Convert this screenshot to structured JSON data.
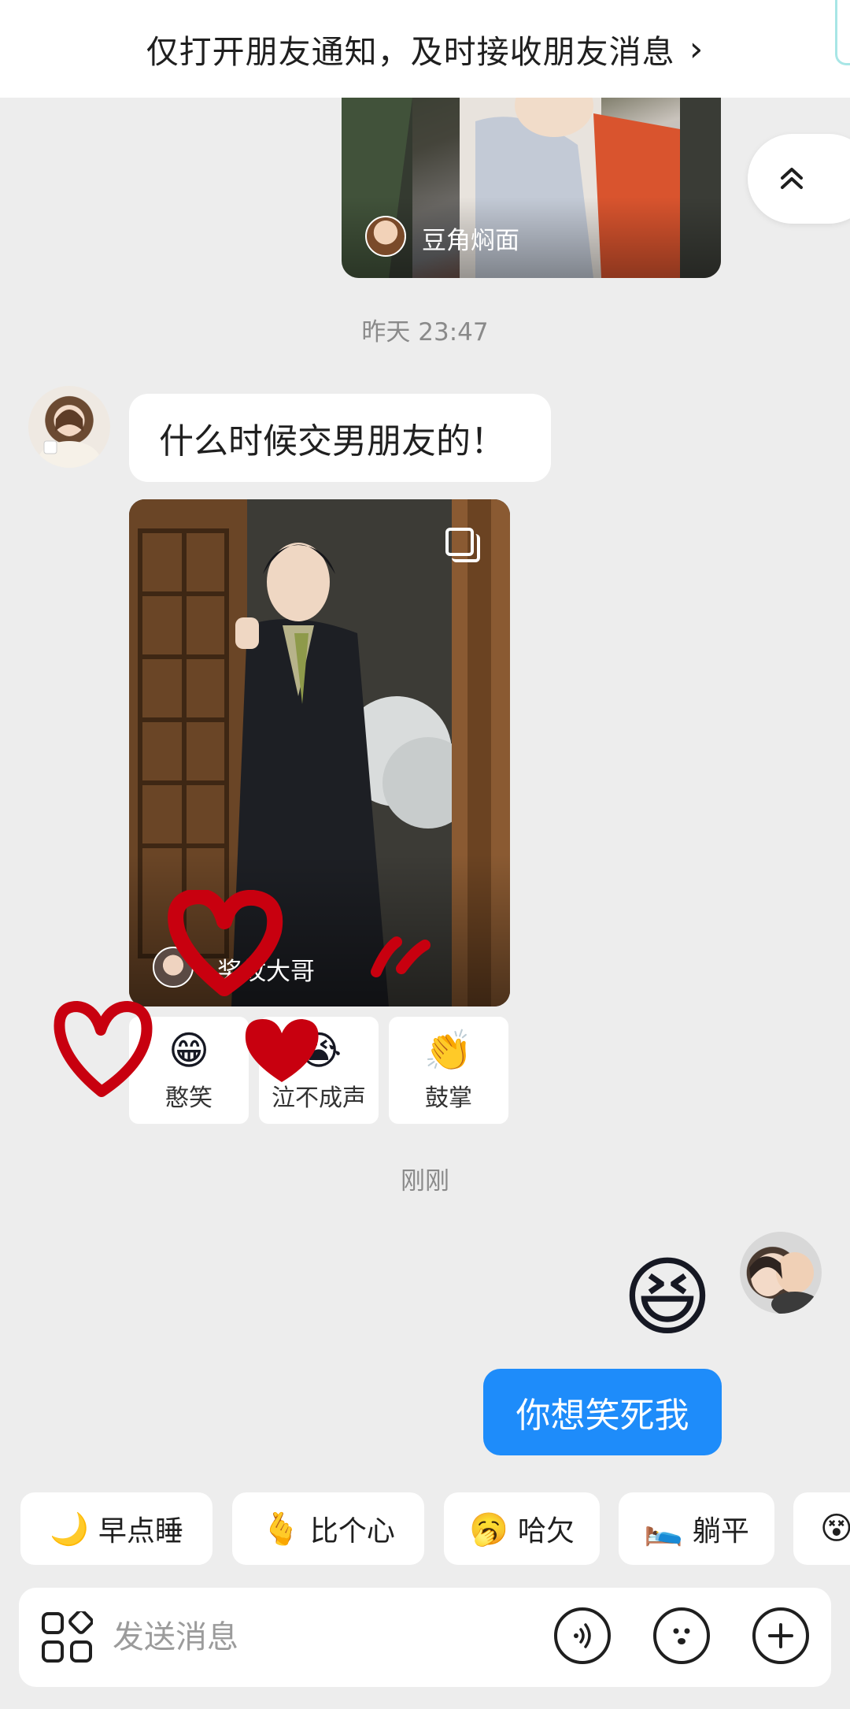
{
  "banner": {
    "text": "仅打开朋友通知，及时接收朋友消息",
    "chevron": "›"
  },
  "messages": {
    "card1": {
      "author": "豆角焖面"
    },
    "timestamp1": "昨天 23:47",
    "friend_text": "什么时候交男朋友的！",
    "card2": {
      "author": "奖纹大哥"
    },
    "reactions": [
      {
        "emoji": "😁",
        "label": "憨笑"
      },
      {
        "emoji": "😭",
        "label": "泣不成声"
      },
      {
        "emoji": "👏",
        "label": "鼓掌"
      }
    ],
    "timestamp2": "刚刚",
    "my_sticker": "😆",
    "my_text": "你想笑死我"
  },
  "quick_replies": [
    {
      "icon": "🌙",
      "label": "早点睡"
    },
    {
      "icon": "🫰",
      "label": "比个心"
    },
    {
      "icon": "🥱",
      "label": "哈欠"
    },
    {
      "icon": "🛌",
      "label": "躺平"
    },
    {
      "icon": "😵",
      "label": ""
    }
  ],
  "input": {
    "placeholder": "发送消息"
  },
  "colors": {
    "accent": "#1e8cfa",
    "background": "#ededed",
    "doodle": "#c8000f"
  }
}
